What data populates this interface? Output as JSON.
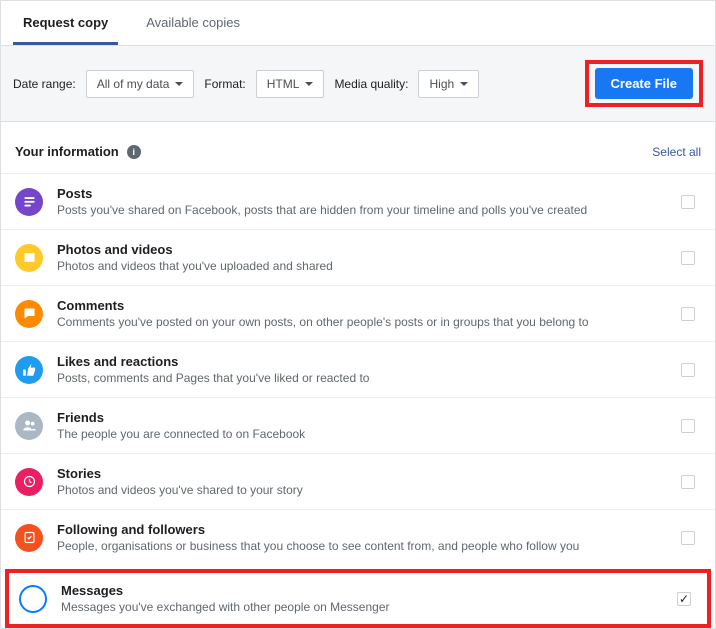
{
  "tabs": {
    "request": "Request copy",
    "available": "Available copies"
  },
  "controls": {
    "dateLabel": "Date range:",
    "dateValue": "All of my data",
    "formatLabel": "Format:",
    "formatValue": "HTML",
    "qualityLabel": "Media quality:",
    "qualityValue": "High",
    "createBtn": "Create File"
  },
  "section": {
    "heading": "Your information",
    "selectAll": "Select all"
  },
  "items": [
    {
      "title": "Posts",
      "desc": "Posts you've shared on Facebook, posts that are hidden from your timeline and polls you've created",
      "iconClass": "ic-posts",
      "iconName": "posts-icon",
      "checked": false
    },
    {
      "title": "Photos and videos",
      "desc": "Photos and videos that you've uploaded and shared",
      "iconClass": "ic-photos",
      "iconName": "photos-icon",
      "checked": false
    },
    {
      "title": "Comments",
      "desc": "Comments you've posted on your own posts, on other people's posts or in groups that you belong to",
      "iconClass": "ic-comments",
      "iconName": "comments-icon",
      "checked": false
    },
    {
      "title": "Likes and reactions",
      "desc": "Posts, comments and Pages that you've liked or reacted to",
      "iconClass": "ic-likes",
      "iconName": "likes-icon",
      "checked": false
    },
    {
      "title": "Friends",
      "desc": "The people you are connected to on Facebook",
      "iconClass": "ic-friends",
      "iconName": "friends-icon",
      "checked": false
    },
    {
      "title": "Stories",
      "desc": "Photos and videos you've shared to your story",
      "iconClass": "ic-stories",
      "iconName": "stories-icon",
      "checked": false
    },
    {
      "title": "Following and followers",
      "desc": "People, organisations or business that you choose to see content from, and people who follow you",
      "iconClass": "ic-following",
      "iconName": "following-icon",
      "checked": false
    },
    {
      "title": "Messages",
      "desc": "Messages you've exchanged with other people on Messenger",
      "iconClass": "ic-messages",
      "iconName": "messages-icon",
      "checked": true,
      "highlight": true
    }
  ]
}
